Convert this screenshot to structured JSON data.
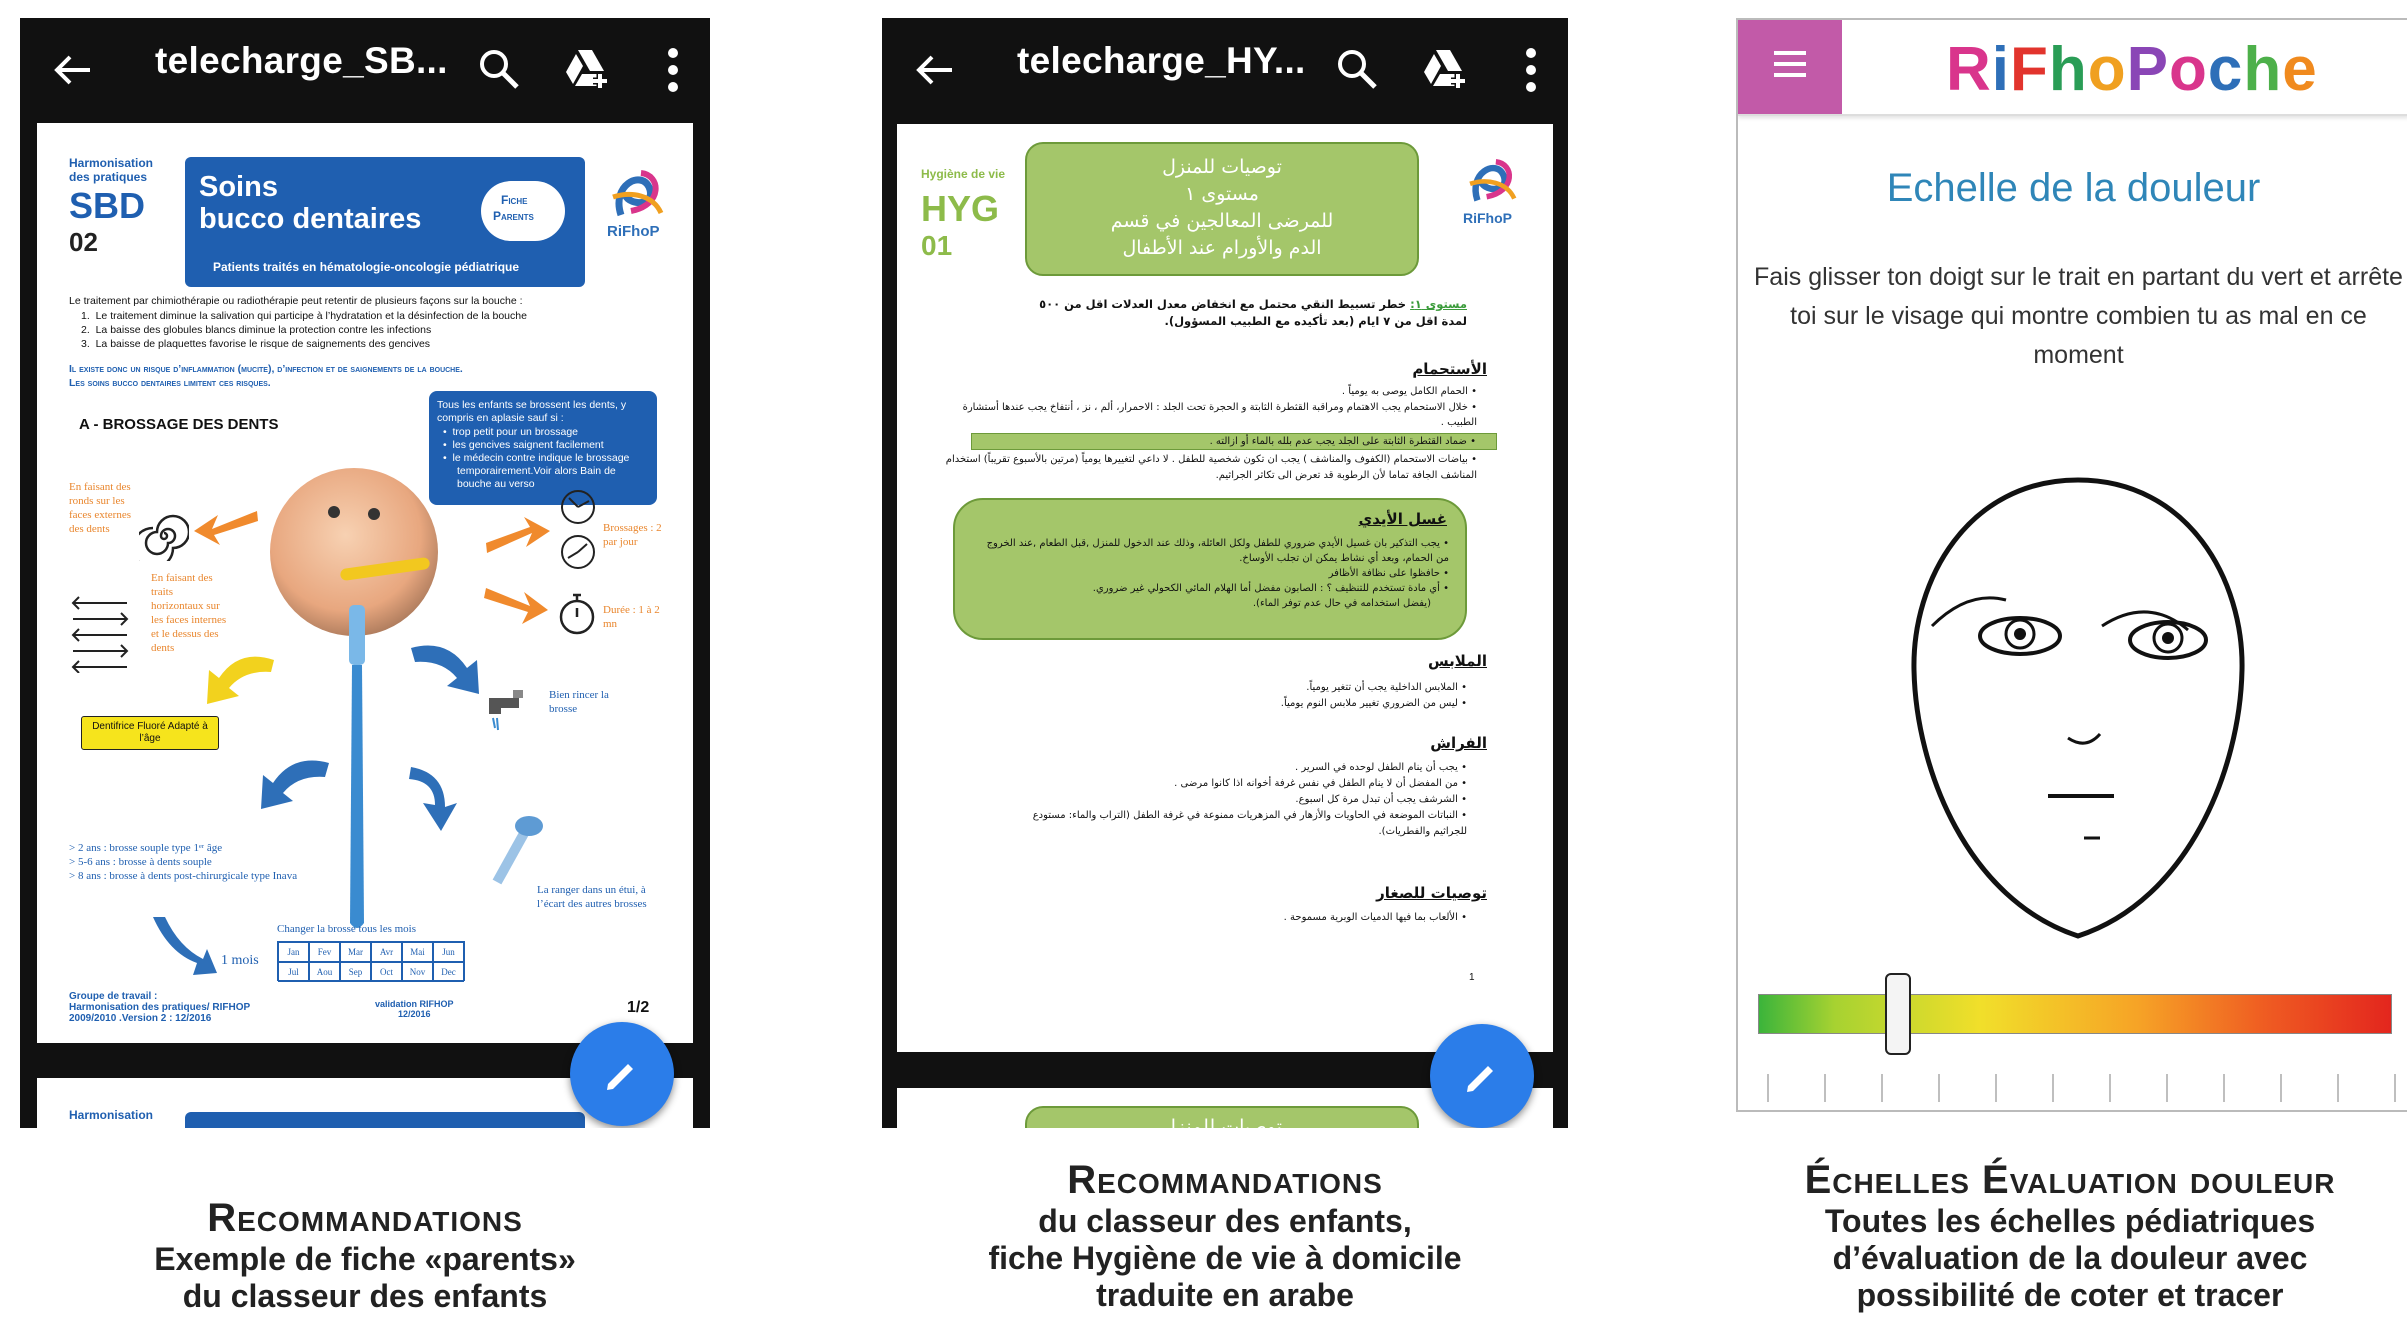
{
  "panels": [
    {
      "title": "telecharge_SB...",
      "caption_head": "Recommandations",
      "caption_lines": [
        "Exemple de fiche «parents»",
        "du classeur des enfants"
      ]
    },
    {
      "title": "telecharge_HY...",
      "caption_head": "Recommandations",
      "caption_lines": [
        "du classeur des enfants,",
        "fiche Hygiène de vie à domicile",
        "traduite en arabe"
      ]
    },
    {
      "caption_head": "Échelles Évaluation douleur",
      "caption_lines": [
        "Toutes les échelles pédiatriques",
        "d’évaluation de la douleur avec",
        "possibilité de coter et tracer"
      ]
    }
  ],
  "sbd": {
    "series": "Harmonisation des pratiques",
    "code": "SBD",
    "num": "02",
    "title1": "Soins",
    "title2": "bucco dentaires",
    "badge1": "Fiche",
    "badge2": "Parents",
    "subtitle": "Patients traités en hématologie-oncologie pédiatrique",
    "logo": "RiFhoP",
    "intro": "Le traitement par chimiothérapie ou radiothérapie peut retentir de plusieurs façons sur la bouche :",
    "intro_items": [
      "Le traitement diminue la salivation qui participe à l’hydratation et la désinfection de la bouche",
      "La baisse des globules blancs diminue la protection contre les infections",
      "La baisse de plaquettes favorise le risque de saignements des gencives"
    ],
    "warn1": "Il existe donc un risque d’inflammation (mucite), d’infection et de saignements de la bouche.",
    "warn2": "Les soins bucco dentaires limitent ces risques.",
    "section": "A - BROSSAGE DES DENTS",
    "bluebox_head": "Tous les enfants se brossent les dents, y compris en aplasie sauf si :",
    "bluebox_items": [
      "trop petit pour un brossage",
      "les gencives saignent facilement",
      "le médecin contre indique le brossage temporairement.Voir alors Bain de bouche au verso"
    ],
    "l1": "En faisant des ronds sur les faces externes des dents",
    "l2": "En faisant des traits horizontaux sur les faces internes et le dessus des dents",
    "r1": "Brossages : 2 par jour",
    "r2": "Durée : 1 à 2 mn",
    "r3": "Bien rincer la brosse",
    "r4": "La ranger dans un étui, à l’écart des autres brosses",
    "tube": "Dentifrice Fluoré Adapté à l’âge",
    "ages": [
      "> 2 ans : brosse souple type 1ᵉʳ âge",
      "> 5-6 ans : brosse à dents souple",
      "> 8 ans : brosse à dents post-chirurgicale type Inava"
    ],
    "change": "Changer la brosse tous les mois",
    "mois": "1 mois",
    "months": [
      "Jan",
      "Fev",
      "Mar",
      "Avr",
      "Mai",
      "Jun",
      "Jul",
      "Aou",
      "Sep",
      "Oct",
      "Nov",
      "Dec"
    ],
    "footer1": "Groupe de travail :",
    "footer2": "Harmonisation des pratiques/ RIFHOP",
    "footer3": "2009/2010 .Version 2 : 12/2016",
    "validation1": "validation RIFHOP",
    "validation2": "12/2016",
    "page": "1/2",
    "next_series": "Harmonisation"
  },
  "hyg": {
    "series": "Hygiène de vie",
    "code": "HYG",
    "num": "01",
    "logo": "RiFhoP",
    "title_lines": [
      "توصيات للمنزل",
      "مستوى ١",
      "للمرضى المعالجين في قسم",
      "الدم والأورام عند الأطفال"
    ],
    "level_label": "مستوى ١:",
    "level_text": "خطر تسبيط النقي محتمل مع انخفاض معدل العدلات اقل من ٥٠٠ لمدة اقل من ٧ ايام (بعد تأكيده مع الطبيب المسؤول).",
    "h_bath": "الأستحمام",
    "bath": [
      "الحمام الكامل يوصى به يومياً .",
      "خلال الاستحمام يجب الاهتمام ومراقبة القثطرة الثابتة و الحجرة تحت الجلد : الاحمرار، ألم ، نز ، أنتفاخ يجب عندها أستشارة الطبيب .",
      "ضماد القثطرة الثابتة على الجلد يجب عدم بلله بالماء أو ازالته .",
      "بياضات الاستحمام (الكفوف والمناشف ) يجب ان تكون شخصية للطفل . لا داعي لتغييرها يومياً (مرتين بالأسبوع تقريباً) استخدام المناشف الجافة تماما لأن الرطوبة قد تعرض الى تكاثر الجراثيم."
    ],
    "h_hands": "غسل الأيدي",
    "hands": [
      "يجب التذكير بان غسيل الأيدي ضروري للطفل ولكل العائلة، وذلك عند الدخول للمنزل ,قبل الطعام ,عند الخروج من الحمام، وبعد أي نشاط يمكن ان تجلب الأوساخ.",
      "حافظوا على نظافة الأظافر",
      "أي مادة تستخدم للتنظيف ؟ : الصابون مفضل أما الهلام المائي الكحولي غير ضروري.",
      "(يفضل استخدامه في حال عدم توفر الماء)."
    ],
    "h_clothes": "الملابس",
    "clothes": [
      "الملابس الداخلية يجب أن تتغير يومياً.",
      "ليس من الضروري تغيير ملابس النوم يومياً."
    ],
    "h_bed": "الفراش",
    "bed": [
      "يجب أن ينام الطفل لوحده في السرير .",
      "من المفضل أن لا ينام الطفل في نفس غرفة أخوانه اذا كانوا مرضى .",
      "الشرشف يجب أن تبدل مرة كل اسبوع.",
      "النباتات الموضعة في الحاويات والأزهار في المزهريات ممنوعة في غرفة الطفل (التراب والماء: مستودع للجراثيم والفطريات)."
    ],
    "h_small": "توصيات للصغار",
    "small": [
      "الألعاب بما فيها الدميات الوبرية مسموحة ."
    ],
    "page": "1",
    "next_title": "توصيات للمنزل"
  },
  "pain": {
    "logo_letters": [
      "R",
      "i",
      "F",
      "h",
      "o",
      "P",
      "o",
      "c",
      "h",
      "e"
    ],
    "logo_colors": [
      "#d9358c",
      "#2e6fb8",
      "#e2342d",
      "#2a9d56",
      "#f0a020",
      "#8a46b6",
      "#d9358c",
      "#2e6fb8",
      "#4db04a",
      "#f08a1e"
    ],
    "title": "Echelle de la douleur",
    "instructions": "Fais glisser ton doigt sur le trait en partant du vert et arrête toi sur le visage qui montre combien tu as mal en ce moment",
    "slider_value": 0.22
  }
}
